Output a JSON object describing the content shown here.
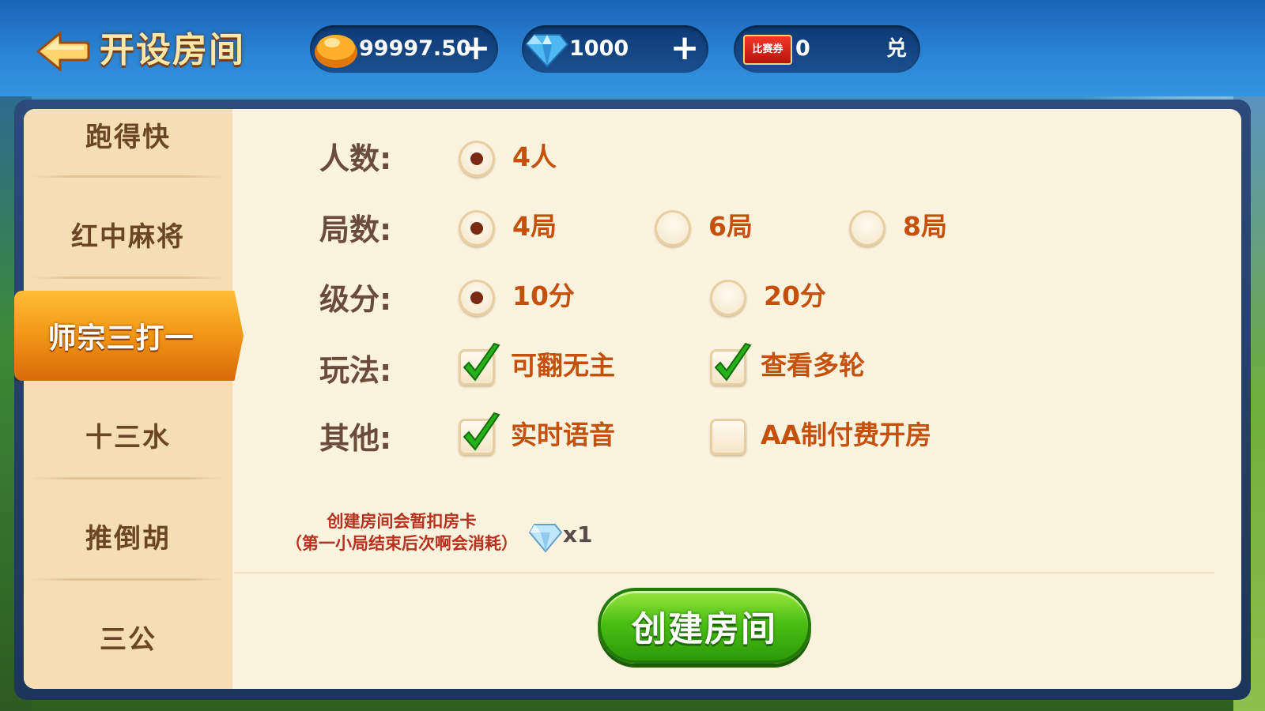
{
  "header": {
    "title": "开设房间",
    "back_icon": "back-arrow-icon",
    "gold": {
      "icon": "gold-ingot-icon",
      "value": "99997.50",
      "action": "+"
    },
    "diamond": {
      "icon": "diamond-icon",
      "value": "1000",
      "action": "+"
    },
    "ticket": {
      "icon_label": "比赛券",
      "value": "0",
      "action": "兑"
    }
  },
  "sidebar": {
    "items": [
      {
        "label": "跑得快"
      },
      {
        "label": "红中麻将"
      },
      {
        "label": "师宗三打一",
        "active": true
      },
      {
        "label": "十三水"
      },
      {
        "label": "推倒胡"
      },
      {
        "label": "三公"
      }
    ]
  },
  "options": {
    "players": {
      "label": "人数:",
      "choices": [
        "4人"
      ],
      "selected": 0
    },
    "rounds": {
      "label": "局数:",
      "choices": [
        "4局",
        "6局",
        "8局"
      ],
      "selected": 0
    },
    "score": {
      "label": "级分:",
      "choices": [
        "10分",
        "20分"
      ],
      "selected": 0
    },
    "gameplay": {
      "label": "玩法:",
      "choices": [
        {
          "text": "可翻无主",
          "checked": true
        },
        {
          "text": "查看多轮",
          "checked": true
        }
      ]
    },
    "other": {
      "label": "其他:",
      "choices": [
        {
          "text": "实时语音",
          "checked": true
        },
        {
          "text": "AA制付费开房",
          "checked": false
        }
      ]
    }
  },
  "notice": {
    "line1": "创建房间会暂扣房卡",
    "line2": "（第一小局结束后次啊会消耗）",
    "cost": "x1"
  },
  "create_button": "创建房间",
  "colors": {
    "accent_orange": "#c4500c",
    "label_brown": "#6a4c3a",
    "button_green": "#4cbf14",
    "active_tab": "#f39a18"
  }
}
